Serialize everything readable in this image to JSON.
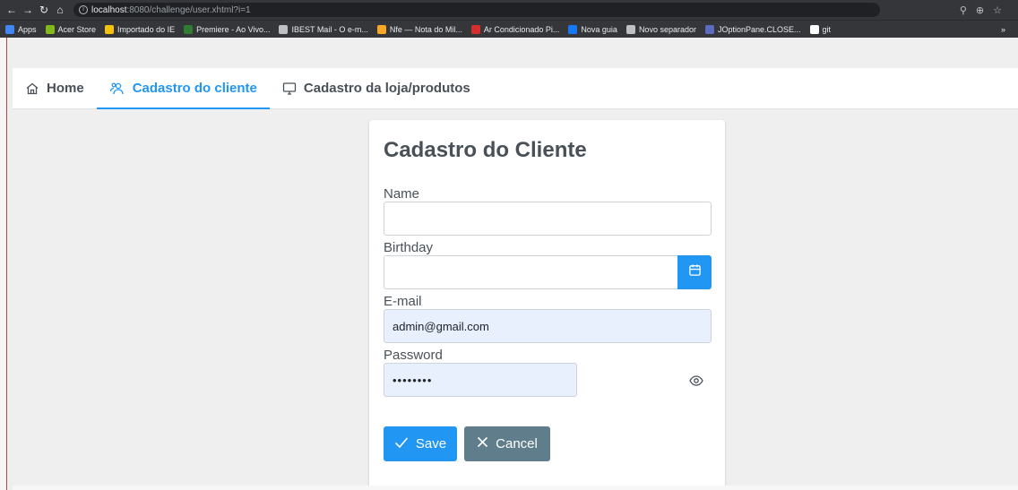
{
  "browser": {
    "url_host": "localhost",
    "url_path": ":8080/challenge/user.xhtml?i=1",
    "bookmarks": [
      {
        "label": "Apps",
        "color": "#4285f4"
      },
      {
        "label": "Acer Store",
        "color": "#83b81a"
      },
      {
        "label": "Importado do IE",
        "color": "#f4c20d"
      },
      {
        "label": "Premiere - Ao Vivo...",
        "color": "#2e7d32"
      },
      {
        "label": "IBEST Mail - O e-m...",
        "color": "#bdc1c6"
      },
      {
        "label": "Nfe — Nota do Mil...",
        "color": "#f9a825"
      },
      {
        "label": "Ar Condicionado Pi...",
        "color": "#d32f2f"
      },
      {
        "label": "Nova guia",
        "color": "#1877f2"
      },
      {
        "label": "Novo separador",
        "color": "#bdc1c6"
      },
      {
        "label": "JOptionPane.CLOSE...",
        "color": "#5c6bc0"
      },
      {
        "label": "git",
        "color": "#ffffff"
      }
    ],
    "bookmarks_more": "»"
  },
  "tabs": [
    {
      "label": "Home",
      "icon": "home-icon",
      "active": false
    },
    {
      "label": "Cadastro do cliente",
      "icon": "users-icon",
      "active": true
    },
    {
      "label": "Cadastro da loja/produtos",
      "icon": "desktop-icon",
      "active": false
    }
  ],
  "form": {
    "title": "Cadastro do Cliente",
    "name_label": "Name",
    "name_value": "",
    "birthday_label": "Birthday",
    "birthday_value": "",
    "email_label": "E-mail",
    "email_value": "admin@gmail.com",
    "password_label": "Password",
    "password_value": "••••••••",
    "save_label": "Save",
    "cancel_label": "Cancel"
  },
  "colors": {
    "primary": "#2196f3",
    "secondary": "#607d8b",
    "autofill": "#e8f0fe"
  }
}
